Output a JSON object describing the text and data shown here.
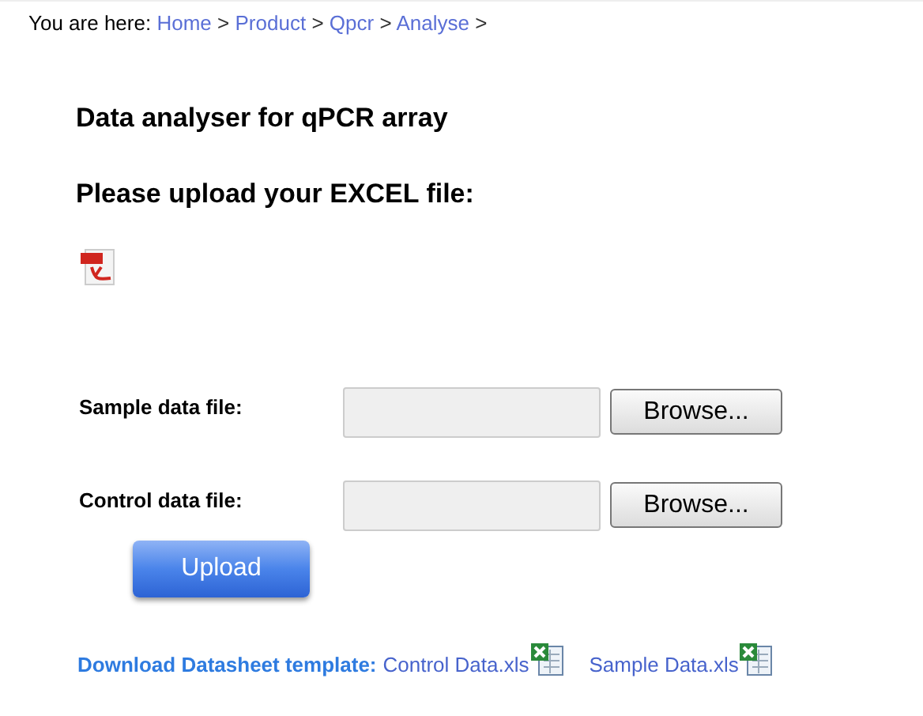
{
  "breadcrumb": {
    "label": "You are here:",
    "items": [
      {
        "text": "Home"
      },
      {
        "text": "Product"
      },
      {
        "text": "Qpcr"
      },
      {
        "text": "Analyse"
      }
    ],
    "separator": ">"
  },
  "title": "Data analyser for qPCR array",
  "subtitle": "Please upload your EXCEL file:",
  "fields": [
    {
      "label": "Sample data file:",
      "button": "Browse..."
    },
    {
      "label": "Control data file:",
      "button": "Browse..."
    }
  ],
  "upload_button": "Upload",
  "download": {
    "label": "Download Datasheet template:",
    "links": [
      {
        "text": "Control Data.xls"
      },
      {
        "text": "Sample Data.xls"
      }
    ]
  }
}
